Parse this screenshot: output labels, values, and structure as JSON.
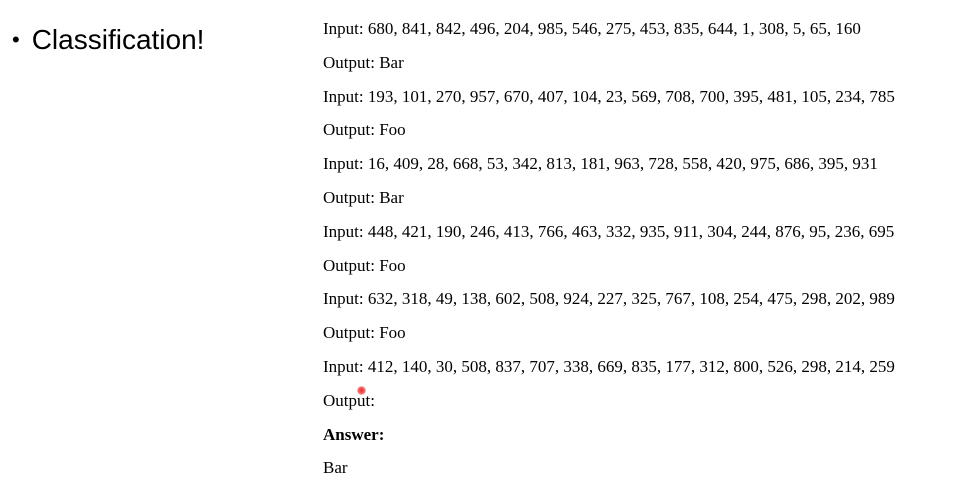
{
  "slide": {
    "bullet_symbol": "•",
    "bullet_text": "Classification!"
  },
  "examples": [
    {
      "input_label": "Input:",
      "input_values": "680, 841, 842, 496, 204, 985, 546, 275, 453, 835, 644, 1, 308, 5, 65, 160",
      "output_label": "Output:",
      "output_value": "Bar"
    },
    {
      "input_label": "Input:",
      "input_values": "193, 101, 270, 957, 670, 407, 104, 23, 569, 708, 700, 395, 481, 105, 234, 785",
      "output_label": "Output:",
      "output_value": "Foo"
    },
    {
      "input_label": "Input:",
      "input_values": "16, 409, 28, 668, 53, 342, 813, 181, 963, 728, 558, 420, 975, 686, 395, 931",
      "output_label": "Output:",
      "output_value": "Bar"
    },
    {
      "input_label": "Input:",
      "input_values": "448, 421, 190, 246, 413, 766, 463, 332, 935, 911, 304, 244, 876, 95, 236, 695",
      "output_label": "Output:",
      "output_value": "Foo"
    },
    {
      "input_label": "Input:",
      "input_values": "632, 318, 49, 138, 602, 508, 924, 227, 325, 767, 108, 254, 475, 298, 202, 989",
      "output_label": "Output:",
      "output_value": "Foo"
    }
  ],
  "query": {
    "input_label": "Input:",
    "input_values": "412, 140, 30, 508, 837, 707, 338, 669, 835, 177, 312, 800, 526, 298, 214, 259",
    "output_label": "Output:"
  },
  "answer": {
    "label": "Answer:",
    "value": "Bar"
  }
}
